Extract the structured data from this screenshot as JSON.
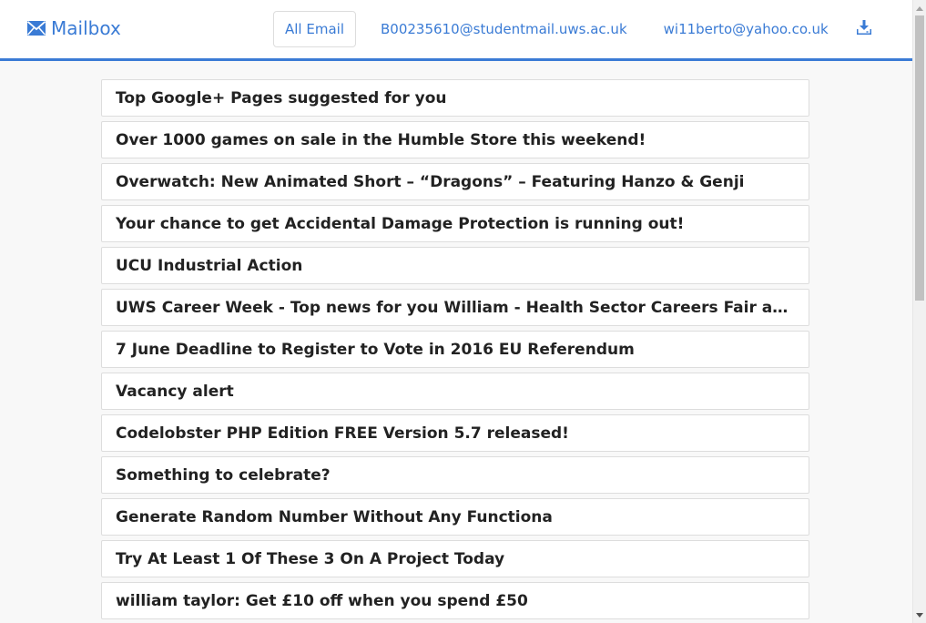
{
  "navbar": {
    "brand": "Mailbox",
    "brand_icon": "envelope-icon",
    "accent_color": "#3a7bd5",
    "links": [
      {
        "label": "All Email",
        "active": true
      },
      {
        "label": "B00235610@studentmail.uws.ac.uk",
        "active": false
      },
      {
        "label": "wi11berto@yahoo.co.uk",
        "active": false
      }
    ],
    "download_icon": "download-icon"
  },
  "emails": [
    {
      "subject": "Top Google+ Pages suggested for you"
    },
    {
      "subject": "Over 1000 games on sale in the Humble Store this weekend!"
    },
    {
      "subject": "Overwatch: New Animated Short – “Dragons” – Featuring Hanzo & Genji"
    },
    {
      "subject": "Your chance to get Accidental Damage Protection is running out!"
    },
    {
      "subject": "UCU Industrial Action"
    },
    {
      "subject": "UWS Career Week - Top news for you William - Health Sector Careers Fair and more..."
    },
    {
      "subject": "7 June Deadline to Register to Vote in 2016 EU Referendum"
    },
    {
      "subject": "Vacancy alert"
    },
    {
      "subject": "Codelobster PHP Edition FREE Version 5.7 released!"
    },
    {
      "subject": "Something to celebrate?"
    },
    {
      "subject": "Generate Random Number Without Any Functiona"
    },
    {
      "subject": "Try At Least 1 Of These 3 On A Project Today"
    },
    {
      "subject": "william taylor: Get £10 off when you spend £50"
    }
  ]
}
